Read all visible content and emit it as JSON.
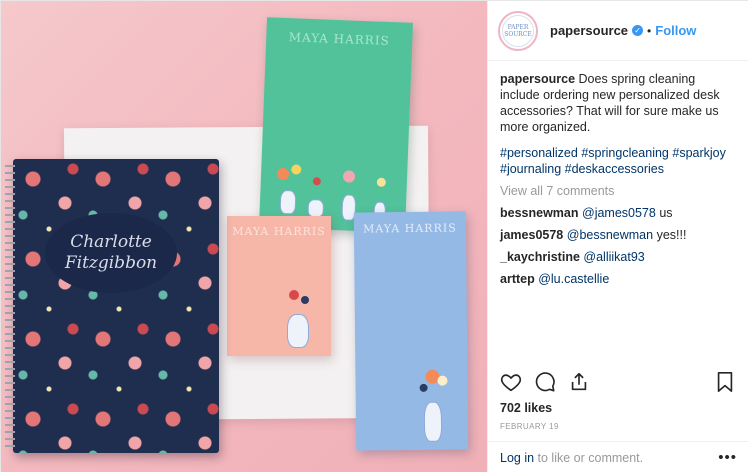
{
  "post": {
    "username": "papersource",
    "avatar_text": "PAPER SOURCE",
    "follow_label": "Follow",
    "separator": "•",
    "caption_text": "Does spring cleaning include ordering new personalized desk accessories? That will for sure make us more organized.",
    "hashtags": [
      "#personalized",
      "#springcleaning",
      "#sparkjoy",
      "#journaling",
      "#deskaccessories"
    ],
    "view_all": "View all 7 comments",
    "comments": [
      {
        "user": "bessnewman",
        "mention": "@james0578",
        "text": " us"
      },
      {
        "user": "james0578",
        "mention": "@bessnewman",
        "text": " yes!!!"
      },
      {
        "user": "_kaychristine",
        "mention": "@alliikat93",
        "text": ""
      },
      {
        "user": "arttep",
        "mention": "@lu.castellie",
        "text": ""
      }
    ],
    "likes": "702 likes",
    "date": "FEBRUARY 19",
    "login_link": "Log in",
    "login_text": " to like or comment.",
    "more_label": "•••"
  },
  "photo": {
    "notebook_name_line1": "Charlotte",
    "notebook_name_line2": "Fitzgibbon",
    "card_name": "MAYA HARRIS"
  },
  "icons": [
    "heart-icon",
    "comment-icon",
    "share-icon",
    "bookmark-icon",
    "verified-icon"
  ],
  "colors": {
    "link": "#003569",
    "follow": "#3897f0",
    "muted": "#999999"
  }
}
